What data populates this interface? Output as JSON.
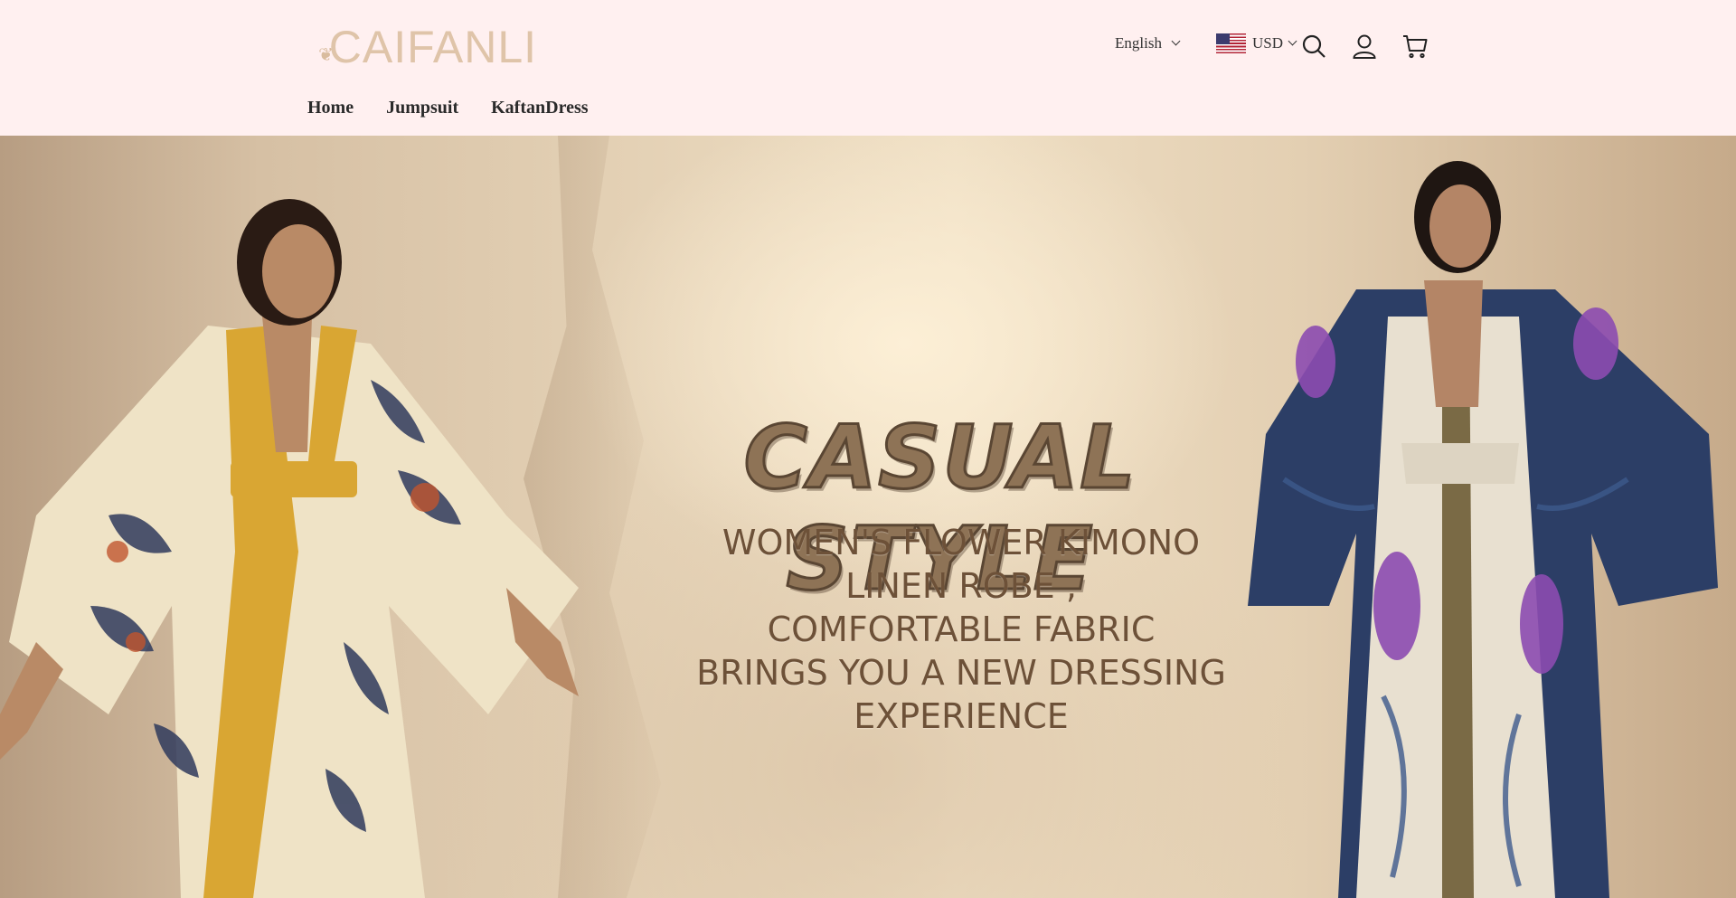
{
  "brand": {
    "logo_text": "CAIFANLI",
    "logo_mark": "❦"
  },
  "header": {
    "language": {
      "selected": "English"
    },
    "currency": {
      "selected": "USD",
      "flag": "us-flag"
    },
    "icons": [
      "search-icon",
      "account-icon",
      "cart-icon"
    ]
  },
  "nav": {
    "items": [
      {
        "label": "Home"
      },
      {
        "label": "Jumpsuit"
      },
      {
        "label": "KaftanDress"
      }
    ]
  },
  "hero": {
    "title": "CASUAL STYLE",
    "subtitle_lines": [
      "WOMEN'S FLOWER KIMONO",
      "LINEN ROBE ,",
      "COMFORTABLE FABRIC",
      "BRINGS YOU A NEW DRESSING",
      "EXPERIENCE"
    ]
  },
  "colors": {
    "header_bg": "#fff0f0",
    "logo": "#dfc4a9",
    "hero_title": "#8e7356",
    "hero_text": "#6d5138"
  }
}
